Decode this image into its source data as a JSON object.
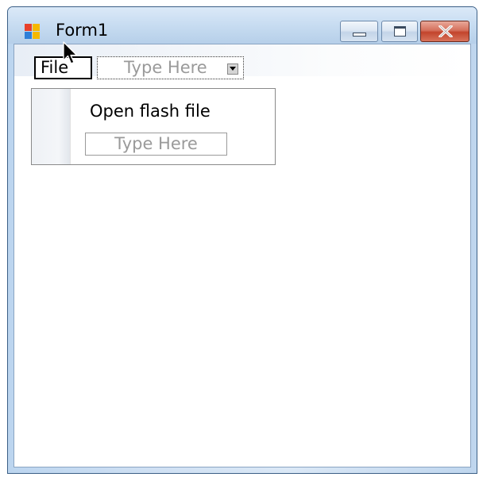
{
  "window": {
    "title": "Form1",
    "icon": "windows-form-icon"
  },
  "caption_buttons": {
    "minimize_icon": "minimize-icon",
    "maximize_icon": "maximize-icon",
    "close_icon": "close-icon"
  },
  "menustrip": {
    "file_label": "File",
    "type_here_label": "Type Here"
  },
  "file_dropdown": {
    "items": [
      {
        "label": "Open flash file"
      },
      {
        "label": "Type Here"
      }
    ]
  },
  "colors": {
    "close_button": "#c2442c",
    "title_bar": "#c7dcf1",
    "placeholder_text": "#9a9a9a"
  }
}
